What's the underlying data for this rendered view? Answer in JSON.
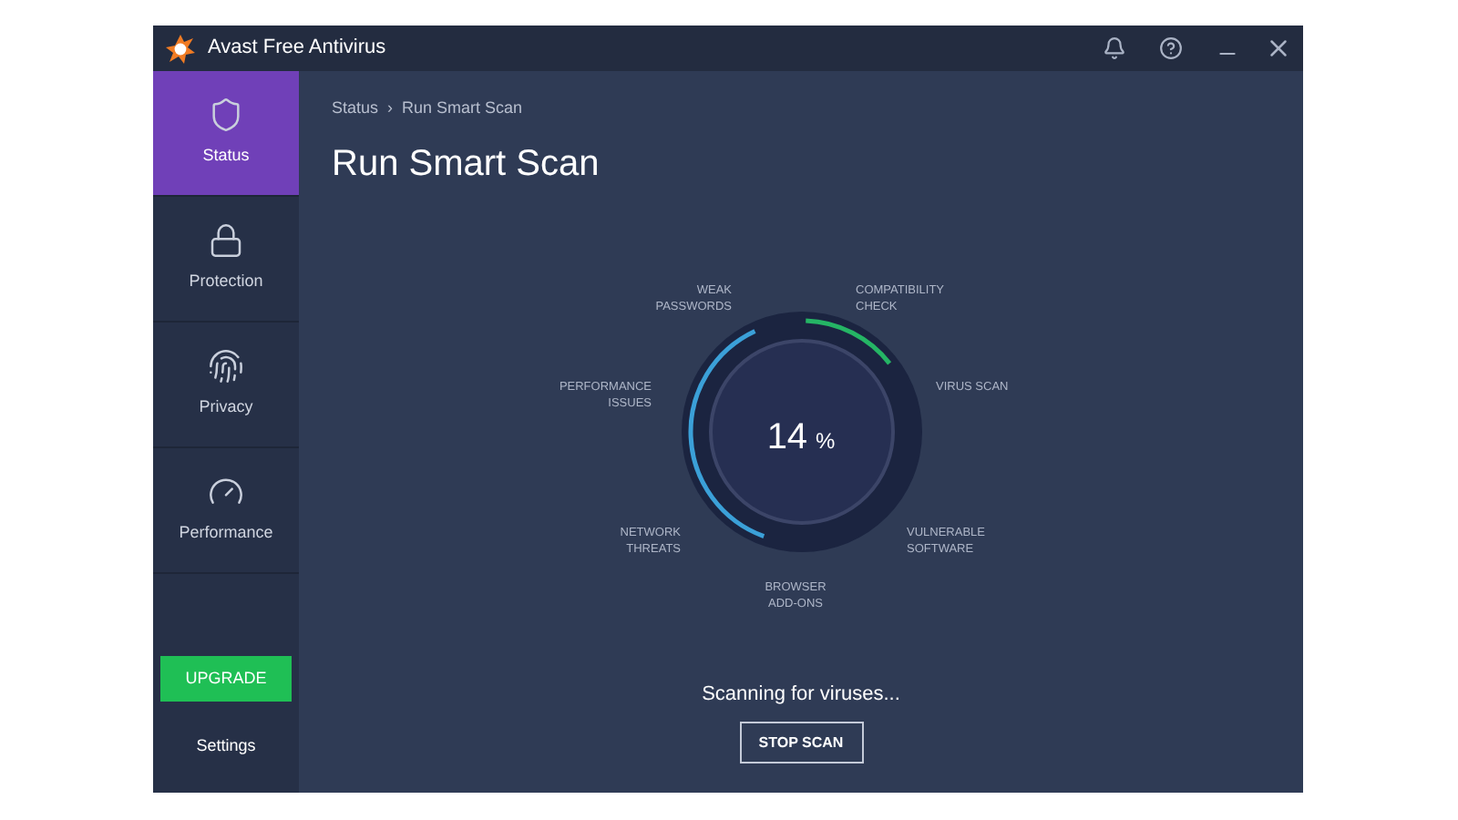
{
  "window": {
    "title": "Avast Free Antivirus"
  },
  "sidebar": {
    "items": [
      {
        "label": "Status",
        "selected": true
      },
      {
        "label": "Protection",
        "selected": false
      },
      {
        "label": "Privacy",
        "selected": false
      },
      {
        "label": "Performance",
        "selected": false
      }
    ],
    "upgrade": "UPGRADE",
    "settings": "Settings"
  },
  "breadcrumb": {
    "parent": "Status",
    "separator": "›",
    "current": "Run Smart Scan"
  },
  "heading": "Run Smart Scan",
  "scan": {
    "percent": "14",
    "unit": "%",
    "stages": [
      "WEAK PASSWORDS",
      "COMPATIBILITY CHECK",
      "PERFORMANCE ISSUES",
      "VIRUS SCAN",
      "NETWORK THREATS",
      "VULNERABLE SOFTWARE",
      "BROWSER ADD-ONS"
    ]
  },
  "status": "Scanning for viruses...",
  "stop_button": "STOP SCAN"
}
